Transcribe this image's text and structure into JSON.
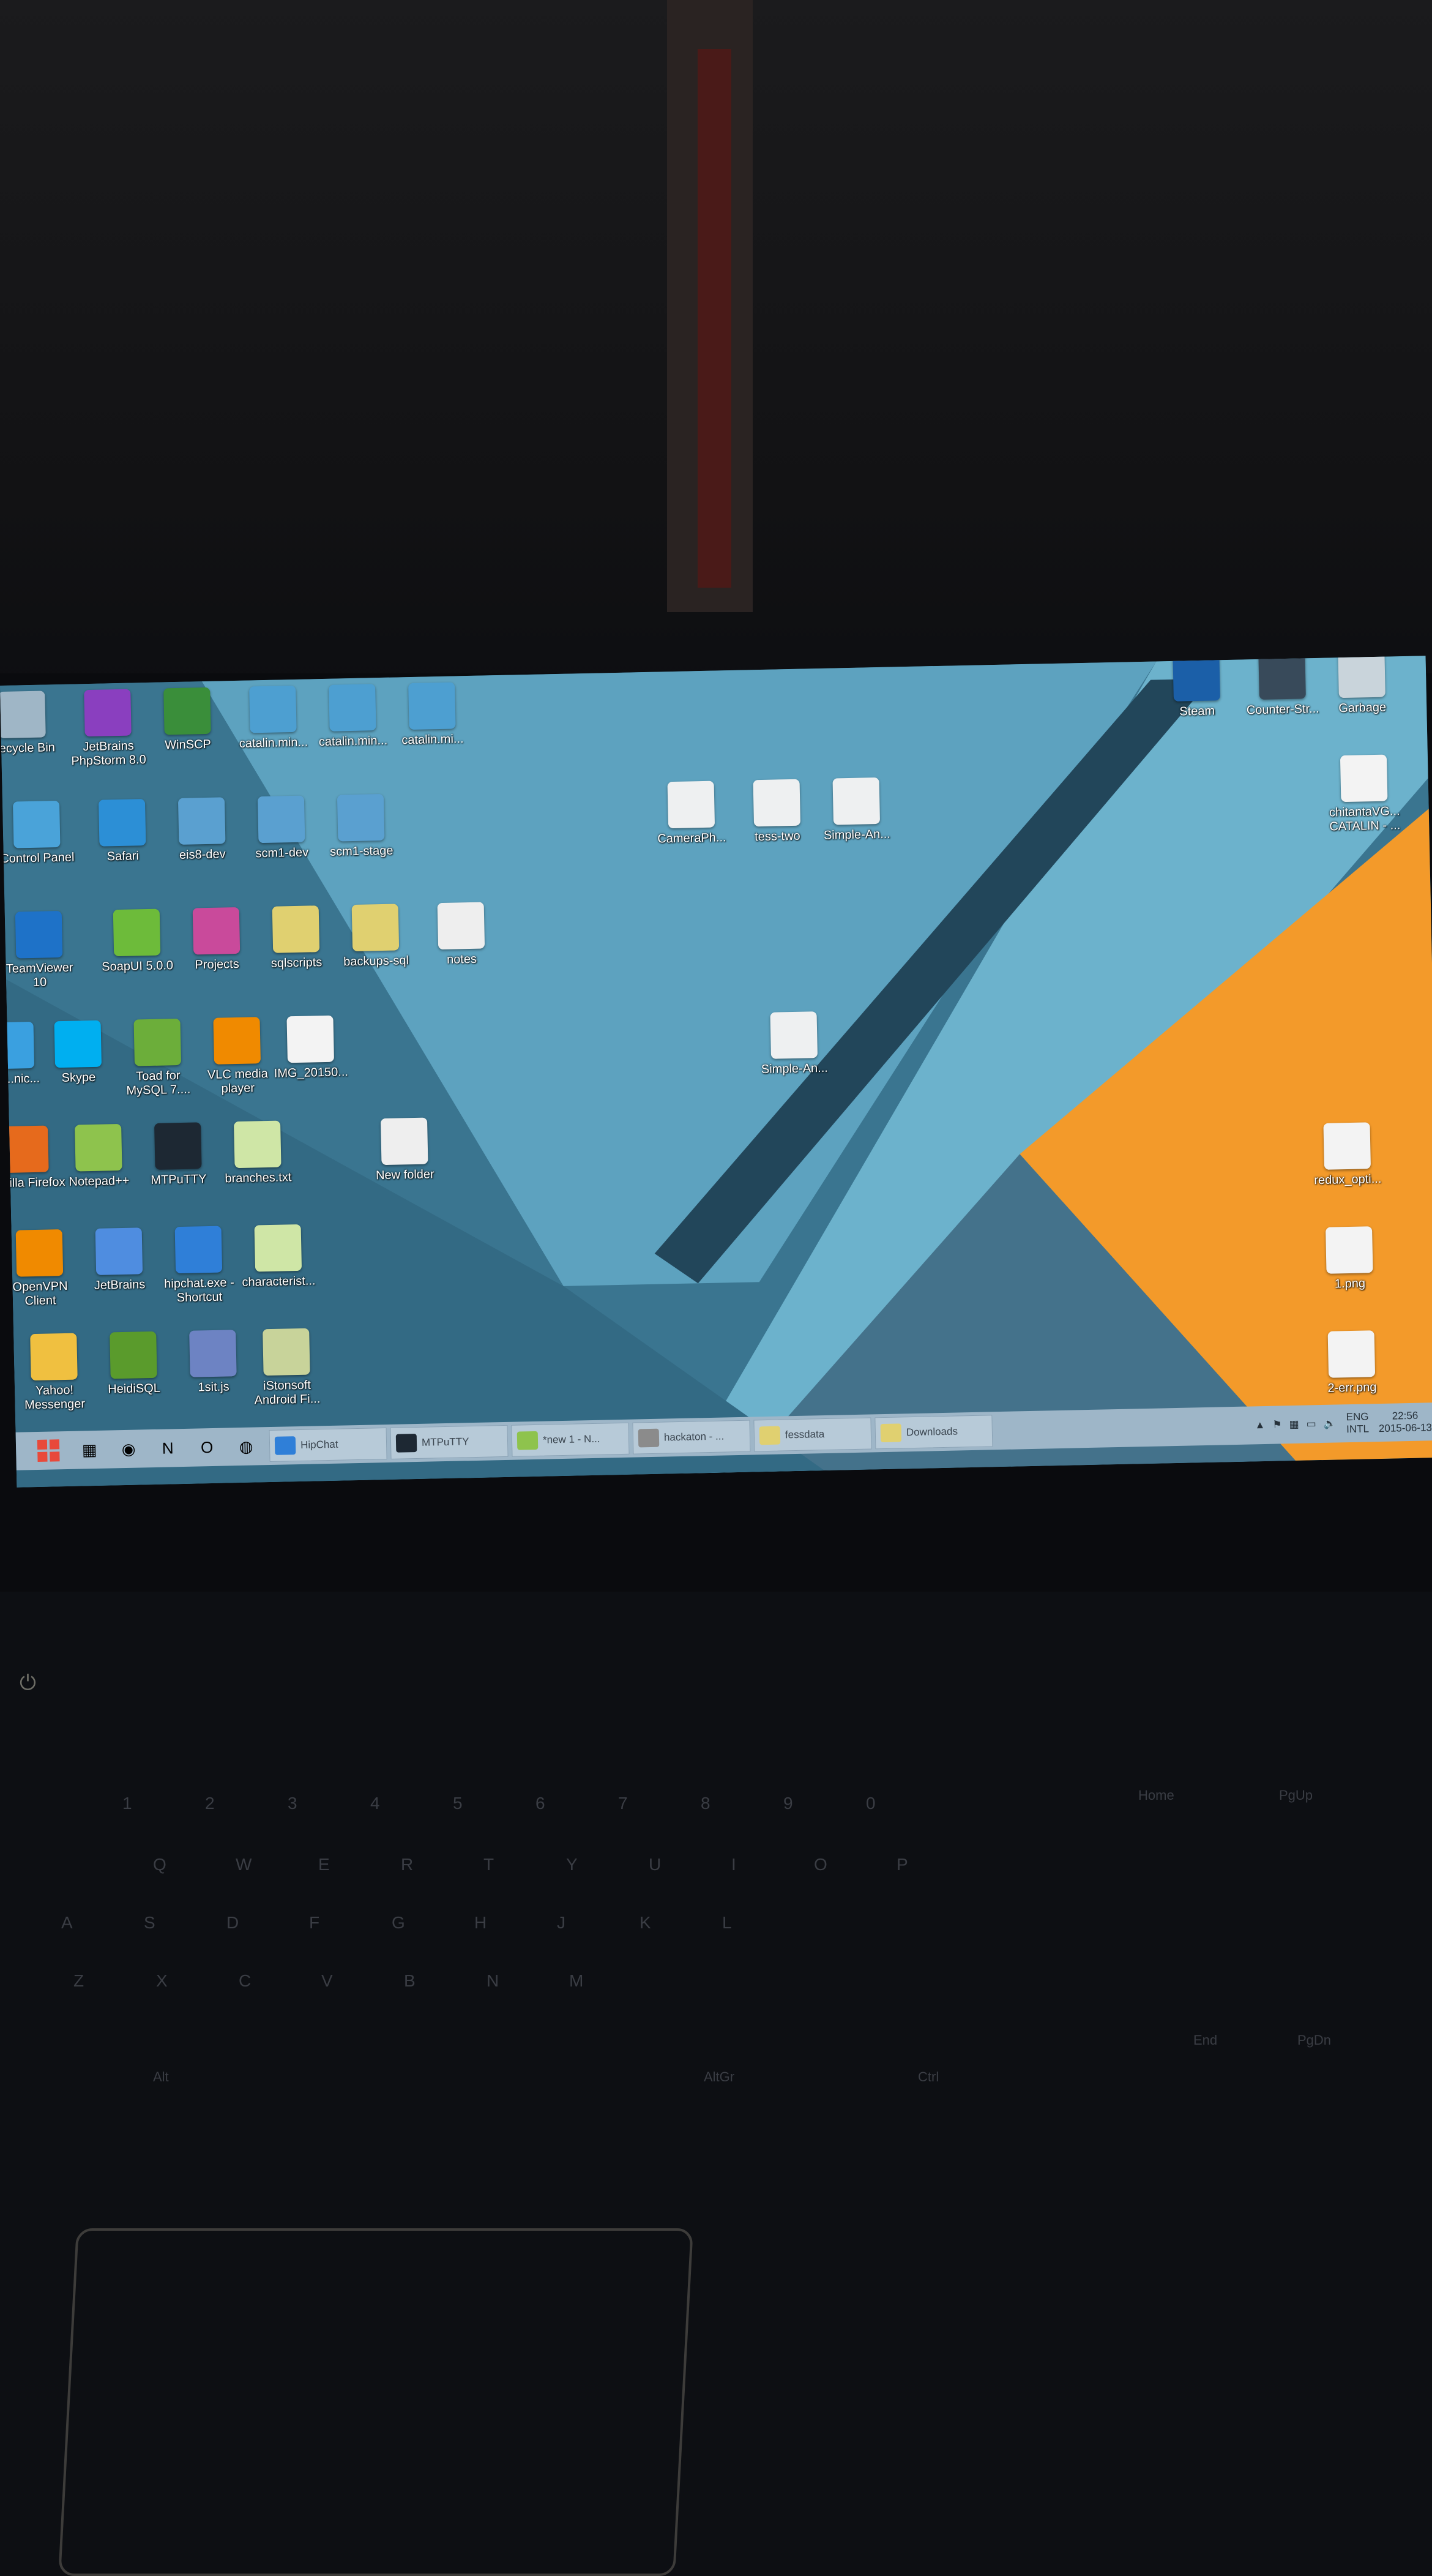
{
  "desktop": {
    "left_icons": [
      {
        "label": "Recycle Bin",
        "icon": "recycle-bin-icon",
        "color": "#9fb6c6"
      },
      {
        "label": "JetBrains PhpStorm 8.0",
        "icon": "phpstorm-icon",
        "color": "#8a3fbf"
      },
      {
        "label": "WinSCP",
        "icon": "winscp-icon",
        "color": "#3a8e3a"
      },
      {
        "label": "catalin.min...",
        "icon": "shortcut-icon",
        "color": "#4d9fd1"
      },
      {
        "label": "catalin.min...",
        "icon": "shortcut-icon",
        "color": "#4d9fd1"
      },
      {
        "label": "catalin.mi...",
        "icon": "shortcut-icon",
        "color": "#4d9fd1"
      },
      {
        "label": "Control Panel",
        "icon": "control-panel-icon",
        "color": "#4aa3d9"
      },
      {
        "label": "Safari",
        "icon": "safari-icon",
        "color": "#2c8fd6"
      },
      {
        "label": "eis8-dev",
        "icon": "putty-shortcut-icon",
        "color": "#5aa0d0"
      },
      {
        "label": "scm1-dev",
        "icon": "putty-shortcut-icon",
        "color": "#5aa0d0"
      },
      {
        "label": "scm1-stage",
        "icon": "putty-shortcut-icon",
        "color": "#5aa0d0"
      },
      {
        "label": "TeamViewer 10",
        "icon": "teamviewer-icon",
        "color": "#1e72c8"
      },
      {
        "label": "SoapUI 5.0.0",
        "icon": "soapui-icon",
        "color": "#6dbb3a"
      },
      {
        "label": "Projects",
        "icon": "folder-icon",
        "color": "#c94a9b"
      },
      {
        "label": "sqlscripts",
        "icon": "folder-icon",
        "color": "#e0d070"
      },
      {
        "label": "backups-sql",
        "icon": "folder-icon",
        "color": "#e0d070"
      },
      {
        "label": "notes",
        "icon": "folder-icon",
        "color": "#eeeeee"
      },
      {
        "label": "HD ...nic...",
        "icon": "app-icon",
        "color": "#3aa0e0"
      },
      {
        "label": "Skype",
        "icon": "skype-icon",
        "color": "#00aff0"
      },
      {
        "label": "Toad for MySQL 7....",
        "icon": "toad-icon",
        "color": "#6cae3a"
      },
      {
        "label": "VLC media player",
        "icon": "vlc-icon",
        "color": "#f08a00"
      },
      {
        "label": "IMG_20150...",
        "icon": "image-file-icon",
        "color": "#f3f3f3"
      },
      {
        "label": "Mozilla Firefox",
        "icon": "firefox-icon",
        "color": "#e66a1c"
      },
      {
        "label": "Notepad++",
        "icon": "notepadpp-icon",
        "color": "#8ec34d"
      },
      {
        "label": "MTPuTTY",
        "icon": "terminal-icon",
        "color": "#1d2833"
      },
      {
        "label": "branches.txt",
        "icon": "text-file-icon",
        "color": "#cfe6a6"
      },
      {
        "label": "New folder",
        "icon": "folder-icon",
        "color": "#eeeeee"
      },
      {
        "label": "OpenVPN Client",
        "icon": "openvpn-icon",
        "color": "#f08a00"
      },
      {
        "label": "JetBrains",
        "icon": "jetbrains-icon",
        "color": "#4f8de0"
      },
      {
        "label": "hipchat.exe - Shortcut",
        "icon": "hipchat-icon",
        "color": "#2f7fd8"
      },
      {
        "label": "characterist...",
        "icon": "text-file-icon",
        "color": "#cfe6a6"
      },
      {
        "label": "Yahoo! Messenger",
        "icon": "yahoo-icon",
        "color": "#f0c040"
      },
      {
        "label": "HeidiSQL",
        "icon": "heidisql-icon",
        "color": "#5a9b2c"
      },
      {
        "label": "1sit.js",
        "icon": "php-file-icon",
        "color": "#6d83c3"
      },
      {
        "label": "iStonsoft Android Fi...",
        "icon": "istonsoft-icon",
        "color": "#c8d39a"
      }
    ],
    "mid_icons": [
      {
        "label": "CameraPh...",
        "icon": "folder-icon"
      },
      {
        "label": "tess-two",
        "icon": "folder-icon"
      },
      {
        "label": "Simple-An...",
        "icon": "folder-icon"
      },
      {
        "label": "Simple-An...",
        "icon": "archive-icon"
      }
    ],
    "right_icons": [
      {
        "label": "Steam",
        "icon": "steam-icon",
        "color": "#1b5fa8"
      },
      {
        "label": "Counter-Str...",
        "icon": "counter-strike-icon",
        "color": "#384a5a"
      },
      {
        "label": "Garbage",
        "icon": "trash-icon",
        "color": "#c9d4db"
      },
      {
        "label": "chitantaVG... CATALIN - ...",
        "icon": "pdf-file-icon",
        "color": "#f3f3f3"
      },
      {
        "label": "redux_opti...",
        "icon": "file-icon",
        "color": "#f3f3f3"
      },
      {
        "label": "1.png",
        "icon": "image-file-icon",
        "color": "#f3f3f3"
      },
      {
        "label": "2-err.png",
        "icon": "image-file-icon",
        "color": "#f3f3f3"
      }
    ]
  },
  "taskbar": {
    "pinned": [
      "file-explorer-icon",
      "chrome-icon",
      "onenote-icon",
      "outlook-icon",
      "firefox-icon"
    ],
    "tasks": [
      {
        "label": "HipChat",
        "color": "#2f7fd8"
      },
      {
        "label": "MTPuTTY",
        "color": "#1d2833"
      },
      {
        "label": "*new 1 - N...",
        "color": "#8ec34d"
      },
      {
        "label": "hackaton - ...",
        "color": "#8b8b8b"
      },
      {
        "label": "fessdata",
        "color": "#e0d070"
      },
      {
        "label": "Downloads",
        "color": "#e0d070"
      }
    ],
    "lang_top": "ENG",
    "lang_bottom": "INTL",
    "time": "22:56",
    "date": "2015-06-13"
  },
  "keyboard": {
    "rows": [
      [
        "1",
        "2",
        "3",
        "4",
        "5",
        "6",
        "7",
        "8",
        "9",
        "0"
      ],
      [
        "Q",
        "W",
        "E",
        "R",
        "T",
        "Y",
        "U",
        "I",
        "O",
        "P"
      ],
      [
        "A",
        "S",
        "D",
        "F",
        "G",
        "H",
        "J",
        "K",
        "L"
      ],
      [
        "Z",
        "X",
        "C",
        "V",
        "B",
        "N",
        "M"
      ]
    ],
    "keys_misc": [
      "Alt",
      "AltGr",
      "Ctrl",
      "Home",
      "End",
      "PgUp",
      "PgDn"
    ]
  },
  "colors": {
    "wallpaper_blue": "#3f7d96",
    "wallpaper_light": "#6cb2cc",
    "wallpaper_orange": "#f39a2a",
    "taskbar": "#9eb6c8"
  }
}
